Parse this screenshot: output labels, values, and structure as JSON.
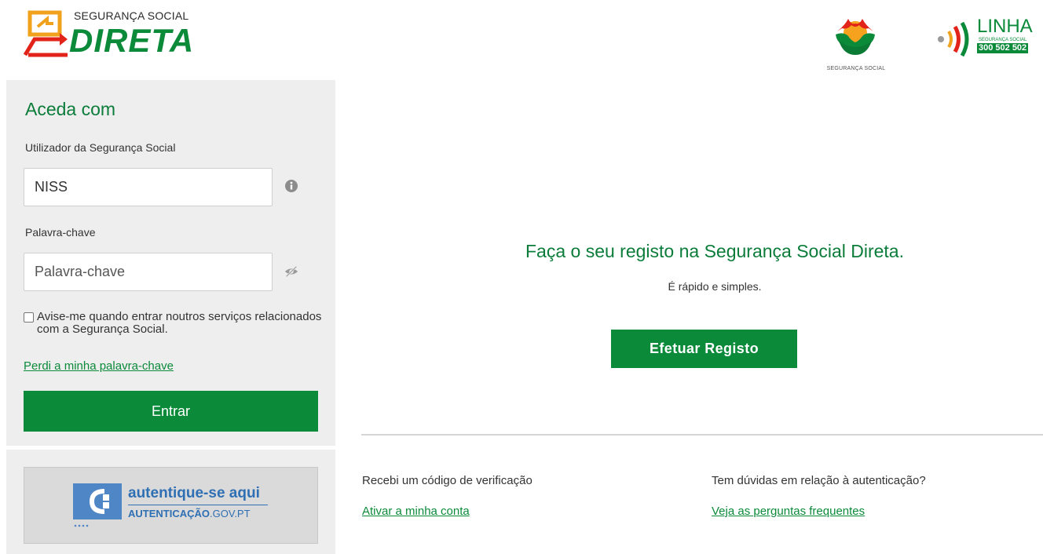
{
  "header": {
    "brand_small": "SEGURANÇA SOCIAL",
    "brand_big": "DIRETA",
    "ss_logo_text": "SEGURANÇA SOCIAL",
    "linha_title": "LINHA",
    "linha_sub": "SEGURANÇA SOCIAL",
    "linha_number": "300 502 502"
  },
  "login": {
    "title": "Aceda com",
    "user_label": "Utilizador da Segurança Social",
    "user_placeholder": "NISS",
    "password_label": "Palavra-chave",
    "password_placeholder": "Palavra-chave",
    "remember_text": "Avise-me quando entrar noutros serviços relacionados com a Segurança Social.",
    "remember_checked": false,
    "forgot_link": "Perdi a minha palavra-chave",
    "submit_label": "Entrar"
  },
  "autenticacao": {
    "main": "autentique-se aqui",
    "sub_bold": "AUTENTICAÇÃO",
    "sub_light": ".GOV.PT"
  },
  "register": {
    "title": "Faça o seu registo na Segurança Social Direta.",
    "subtitle": "É rápido e simples.",
    "button_label": "Efetuar Registo"
  },
  "help": {
    "left_label": "Recebi um código de verificação",
    "left_link": "Ativar a minha conta",
    "right_label": "Tem dúvidas em relação à autenticação?",
    "right_link": "Veja as perguntas frequentes"
  },
  "colors": {
    "primary_green": "#0b8a3a",
    "title_green": "#0b7c3a",
    "panel_bg": "#eeeeee",
    "autenticacao_blue": "#2f6fb3"
  },
  "icons": {
    "info": "info-icon",
    "toggle_password": "eye-slash-icon"
  }
}
